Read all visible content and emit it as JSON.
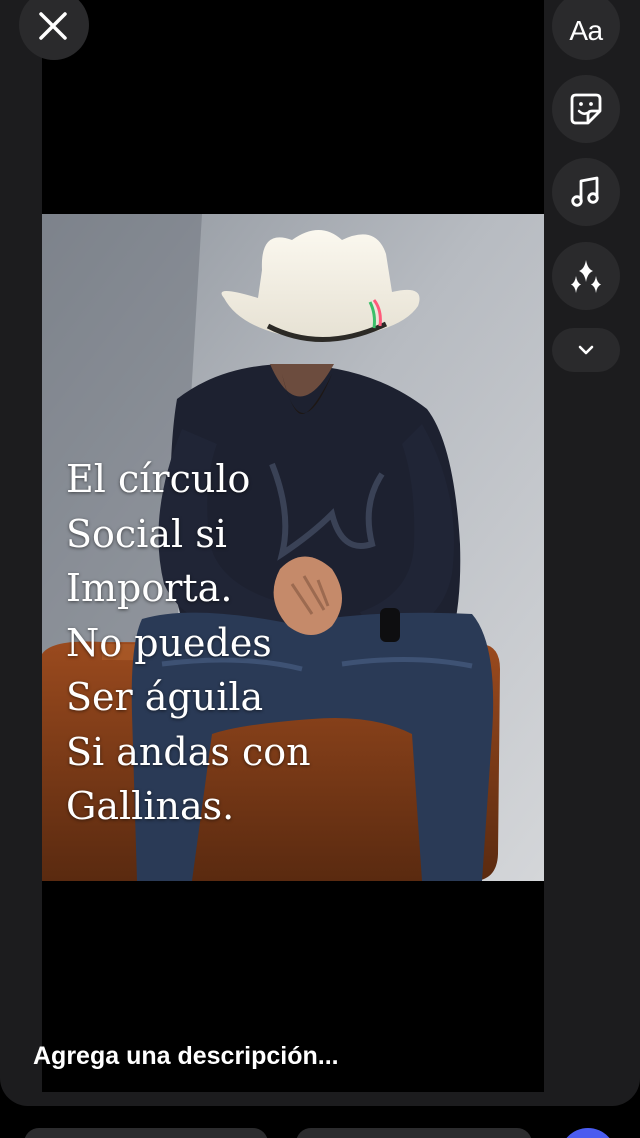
{
  "story": {
    "quote_lines": [
      "El círculo",
      "Social si",
      "Importa.",
      "No puedes",
      "Ser águila",
      "Si andas con",
      "Gallinas."
    ],
    "caption_placeholder": "Agrega una descripción..."
  },
  "toolbar": {
    "text_label": "Aa",
    "icons": [
      "text-tool",
      "sticker-icon",
      "music-icon",
      "sparkles-icon",
      "chevron-down-icon"
    ]
  },
  "header": {
    "close_icon": "close-icon"
  },
  "colors": {
    "panel": "#1c1c1e",
    "button": "#2a2a2c",
    "accent": "#4a5cf0",
    "text": "#ffffff"
  }
}
